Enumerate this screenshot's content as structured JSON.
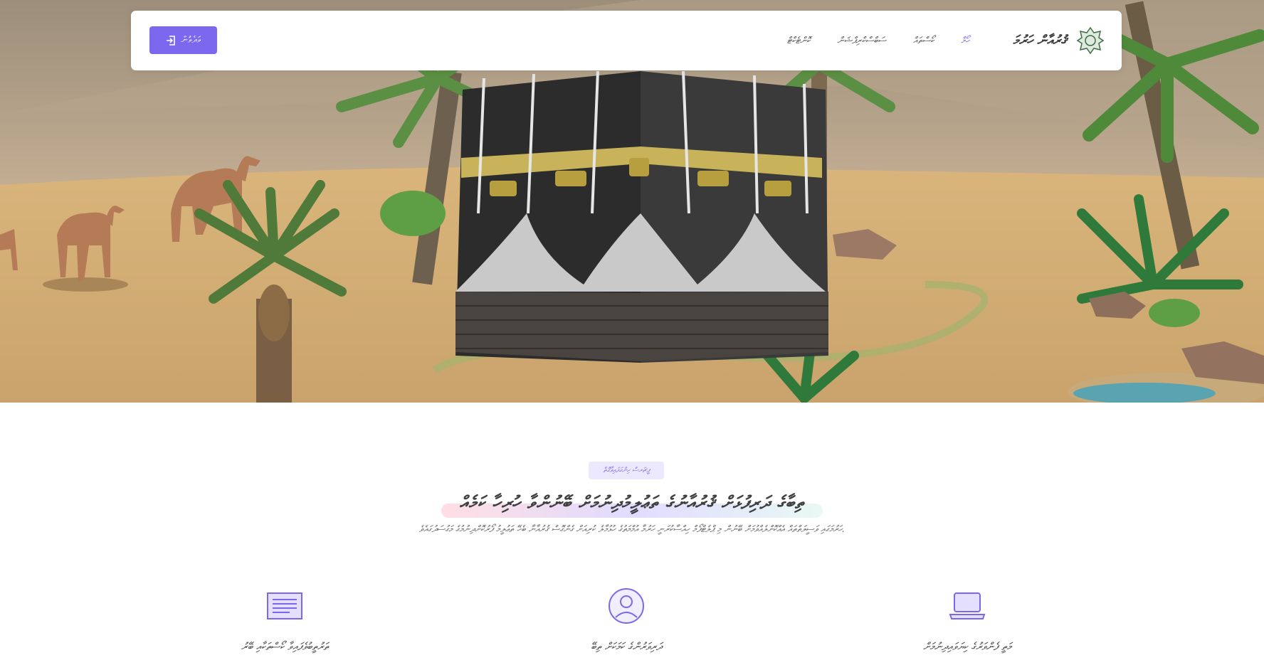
{
  "navbar": {
    "brand_name": "ޤުރުއާން ހަރުމަ",
    "login_label": "ވަދެވުން",
    "links": [
      {
        "label": "ހޯމް",
        "active": true
      },
      {
        "label": "ކޯސްތައް",
        "active": false
      },
      {
        "label": "ސަބްސްކްރިޕްޝަން",
        "active": false
      },
      {
        "label": "ކޮންޓެކްޓް",
        "active": false
      }
    ]
  },
  "hero": {
    "icon": "kaaba-illustration"
  },
  "section": {
    "tag": "ފީޗަރސް ހިންގަފައިވާގޮތް",
    "heading": "ތިބާގެ ދަރިފުޅަށް ޤުރުއާނުގެ ތަޢުލީމުދިނުމަށް ބޭނުންވާ ހުރިހާ ކަމެއް",
    "subheading": "ހަރުމަގައި ވަސީލަތްތައް އެއްކޮށްލެއްވުމަށް ބޭނުން މި ޕްލެޓްފޯމް ހިއްސާކުރަނީ ހަރުމާ އުމްމަތުގެ ހުޅުމާލެ ކުރިއަށް ގެންގޮސް ޤުރުއާނާ ބެހޭ ތަޢުލީމު ފޯރުކޮށްދިނުމުގެ މަގުސަދުގައެވެ.",
    "features": [
      {
        "label": "މަތީ ފެންވަރުގެ ކިޔަވައިދިނުމަށް",
        "icon": "laptop-icon"
      },
      {
        "label": "ދަރިވަރުންގެ ކަމަކަށް ތިބޭ",
        "icon": "user-circle-icon"
      },
      {
        "label": "ތަރުތީބުވެފައިވާ ކޯސްތަކާއި ބޭރު",
        "icon": "document-lines-icon"
      }
    ]
  },
  "colors": {
    "accent": "#7b68ee",
    "tag_bg": "#ece9ff"
  }
}
